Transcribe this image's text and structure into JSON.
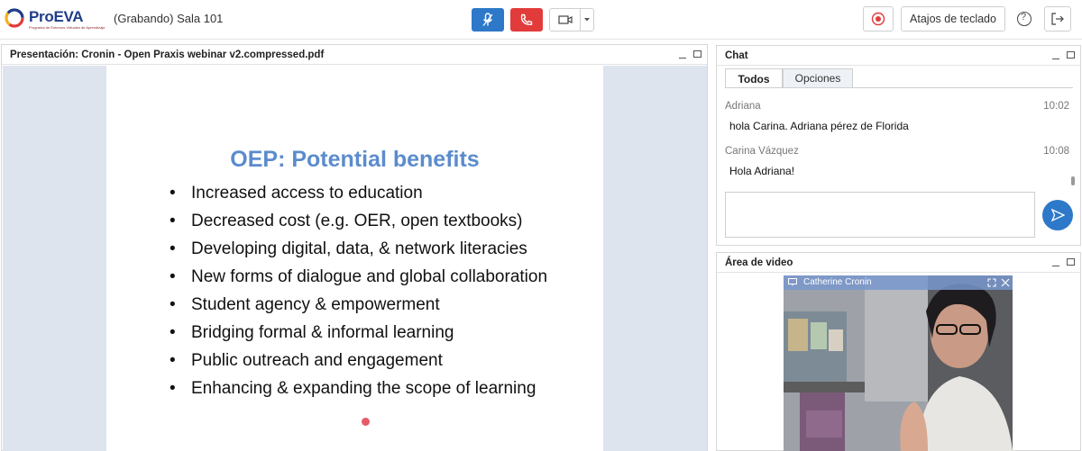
{
  "header": {
    "logo_text": "ProEVA",
    "logo_subtitle": "Programa de Entornos Virtuales de Aprendizaje",
    "room_title": "(Grabando) Sala 101",
    "keyboard_shortcuts_label": "Atajos de teclado",
    "help_glyph": "?",
    "colors": {
      "mic": "#2d78c8",
      "hangup": "#e23b3b",
      "record": "#e23b3b"
    }
  },
  "presentation": {
    "panel_title": "Presentación: Cronin - Open Praxis webinar v2.compressed.pdf",
    "slide_title": "OEP: Potential benefits",
    "bullets": [
      "Increased access to education",
      "Decreased cost (e.g. OER, open textbooks)",
      "Developing digital, data, & network literacies",
      "New forms of dialogue and global collaboration",
      "Student agency & empowerment",
      "Bridging formal & informal learning",
      "Public outreach and engagement",
      "Enhancing & expanding the scope of learning"
    ]
  },
  "chat": {
    "panel_title": "Chat",
    "tabs": [
      "Todos",
      "Opciones"
    ],
    "messages": [
      {
        "name": "Adriana",
        "time": "10:02",
        "text": "hola Carina. Adriana pérez de Florida"
      },
      {
        "name": "Carina Vázquez",
        "time": "10:08",
        "text": "Hola Adriana!"
      }
    ],
    "input_placeholder": ""
  },
  "video": {
    "panel_title": "Área de video",
    "participant_name": "Catherine Cronin"
  },
  "icons": [
    "microphone-icon",
    "phone-hangup-icon",
    "camera-icon",
    "chevron-down-icon",
    "record-icon",
    "help-icon",
    "exit-icon",
    "send-icon",
    "minimize-icon",
    "maximize-icon",
    "expand-icon",
    "close-icon",
    "screen-icon"
  ]
}
